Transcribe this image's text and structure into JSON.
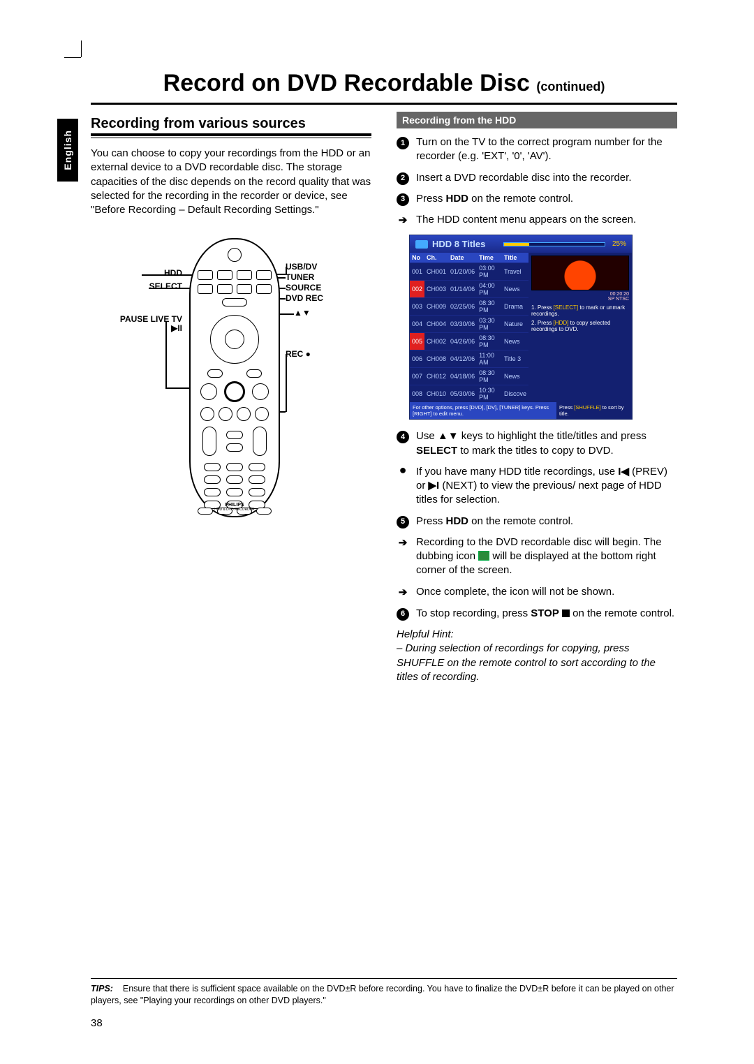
{
  "side_tab": "English",
  "main_title": "Record on DVD Recordable Disc",
  "main_title_cont": "(continued)",
  "left": {
    "section_title": "Recording from various sources",
    "intro": "You can choose to copy your recordings from the HDD or an external device to a DVD recordable disc. The storage capacities of the disc depends on the record quality that was selected for the recording in the recorder or device, see \"Before Recording – Default Recording Settings.\""
  },
  "remote_labels": {
    "hdd": "HDD",
    "select": "SELECT",
    "pause": "PAUSE LIVE TV",
    "pause_icon": "▶II",
    "usb": "USB/DV",
    "tuner": "TUNER",
    "source": "SOURCE",
    "dvdrec": "DVD REC",
    "updown": "▲▼",
    "rec": "REC ●",
    "brand": "PHILIPS",
    "brand_sub": "HDD & DVD RECORDER"
  },
  "right": {
    "header": "Recording from the HDD",
    "step1": "Turn on the TV to the correct program number for the recorder (e.g. 'EXT', '0', 'AV').",
    "step2": "Insert a DVD recordable disc into the recorder.",
    "step3_a": "Press ",
    "step3_b": "HDD",
    "step3_c": " on the remote control.",
    "step3_res": "The HDD content menu appears on the screen.",
    "step4_a": "Use ",
    "step4_b": " keys to highlight the title/titles and press ",
    "step4_c": "SELECT",
    "step4_d": " to mark the titles to copy to DVD.",
    "step4_tip_a": "If you have many HDD title recordings, use  ",
    "step4_tip_b": " (PREV) or  ",
    "step4_tip_c": " (NEXT) to view the previous/ next page of HDD titles for selection.",
    "step5_a": "Press ",
    "step5_b": "HDD",
    "step5_c": " on the remote control.",
    "step5_res1_a": "Recording to the DVD recordable disc will begin.  The dubbing icon ",
    "step5_res1_b": " will be displayed at the bottom right corner of the screen.",
    "step5_res2": "Once complete, the icon will not be shown.",
    "step6_a": "To stop recording, press ",
    "step6_b": "STOP",
    "step6_c": "  on the remote control.",
    "hint_label": "Helpful Hint:",
    "hint_text": "– During selection of recordings for copying, press SHUFFLE on the remote control to sort according to the titles of recording."
  },
  "hdd_menu": {
    "title": "HDD 8 Titles",
    "percent": "25%",
    "cols": [
      "No",
      "Ch.",
      "Date",
      "Time",
      "Title"
    ],
    "rows": [
      {
        "no": "001",
        "ch": "CH001",
        "date": "01/20/06",
        "time": "03:00 PM",
        "title": "Travel",
        "m": false
      },
      {
        "no": "002",
        "ch": "CH003",
        "date": "01/14/06",
        "time": "04:00 PM",
        "title": "News",
        "m": true
      },
      {
        "no": "003",
        "ch": "CH009",
        "date": "02/25/06",
        "time": "08:30 PM",
        "title": "Drama",
        "m": false
      },
      {
        "no": "004",
        "ch": "CH004",
        "date": "03/30/06",
        "time": "03:30 PM",
        "title": "Nature",
        "m": false
      },
      {
        "no": "005",
        "ch": "CH002",
        "date": "04/26/06",
        "time": "08:30 PM",
        "title": "News",
        "m": true
      },
      {
        "no": "006",
        "ch": "CH008",
        "date": "04/12/06",
        "time": "11:00 AM",
        "title": "Title 3",
        "m": false
      },
      {
        "no": "007",
        "ch": "CH012",
        "date": "04/18/06",
        "time": "08:30 PM",
        "title": "News",
        "m": false
      },
      {
        "no": "008",
        "ch": "CH010",
        "date": "05/30/06",
        "time": "10:30 PM",
        "title": "Discove",
        "m": false
      }
    ],
    "meta1": "00:20:20",
    "meta2": "SP NTSC",
    "tip1_a": "1. Press ",
    "tip1_b": "[SELECT]",
    "tip1_c": " to mark or unmark recordings.",
    "tip2_a": "2. Press ",
    "tip2_b": "[HDD]",
    "tip2_c": " to copy selected recordings to DVD.",
    "bot_left": "For other options, press [DVD], [DV], [TUNER] keys. Press [RIGHT] to edit menu.",
    "bot_right_a": "Press ",
    "bot_right_b": "[SHUFFLE]",
    "bot_right_c": " to sort by title."
  },
  "tips": {
    "label": "TIPS:",
    "text": "Ensure that there is sufficient space available on the DVD±R before recording. You have to finalize the DVD±R before it can be played on other players, see \"Playing your recordings on other DVD players.\""
  },
  "page_number": "38"
}
